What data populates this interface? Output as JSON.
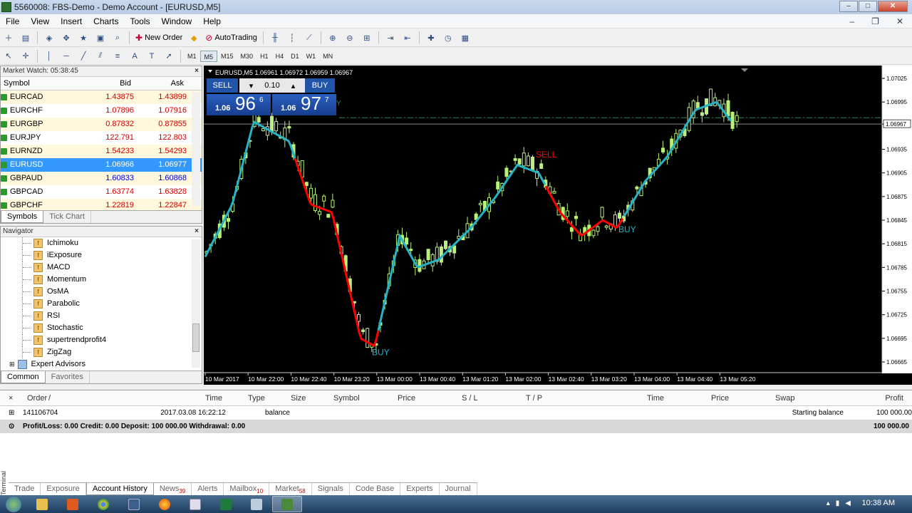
{
  "window": {
    "title": "5560008: FBS-Demo - Demo Account - [EURUSD,M5]"
  },
  "menu": [
    "File",
    "View",
    "Insert",
    "Charts",
    "Tools",
    "Window",
    "Help"
  ],
  "toolbar": {
    "new_order": "New Order",
    "autotrading": "AutoTrading"
  },
  "timeframes": [
    "M1",
    "M5",
    "M15",
    "M30",
    "H1",
    "H4",
    "D1",
    "W1",
    "MN"
  ],
  "active_timeframe": "M5",
  "market_watch": {
    "title": "Market Watch: 05:38:45",
    "columns": [
      "Symbol",
      "Bid",
      "Ask"
    ],
    "rows": [
      {
        "symbol": "EURCAD",
        "bid": "1.43875",
        "ask": "1.43899",
        "dir": "up"
      },
      {
        "symbol": "EURCHF",
        "bid": "1.07896",
        "ask": "1.07916",
        "dir": "up"
      },
      {
        "symbol": "EURGBP",
        "bid": "0.87832",
        "ask": "0.87855",
        "dir": "up"
      },
      {
        "symbol": "EURJPY",
        "bid": "122.791",
        "ask": "122.803",
        "dir": "up"
      },
      {
        "symbol": "EURNZD",
        "bid": "1.54233",
        "ask": "1.54293",
        "dir": "up"
      },
      {
        "symbol": "EURUSD",
        "bid": "1.06966",
        "ask": "1.06977",
        "dir": "up",
        "selected": true
      },
      {
        "symbol": "GBPAUD",
        "bid": "1.60833",
        "ask": "1.60868",
        "dir": "up",
        "blue": true
      },
      {
        "symbol": "GBPCAD",
        "bid": "1.63774",
        "ask": "1.63828",
        "dir": "up"
      },
      {
        "symbol": "GBPCHF",
        "bid": "1.22819",
        "ask": "1.22847",
        "dir": "up"
      }
    ],
    "tabs": [
      "Symbols",
      "Tick Chart"
    ]
  },
  "navigator": {
    "title": "Navigator",
    "items": [
      "Ichimoku",
      "iExposure",
      "MACD",
      "Momentum",
      "OsMA",
      "Parabolic",
      "RSI",
      "Stochastic",
      "supertrendprofit4",
      "ZigZag"
    ],
    "expert_advisors": "Expert Advisors",
    "tabs": [
      "Common",
      "Favorites"
    ]
  },
  "chart": {
    "info": "EURUSD,M5  1.06961 1.06972 1.06959 1.06967",
    "sell_label": "SELL",
    "buy_label": "BUY",
    "lot": "0.10",
    "sell_price": {
      "small": "1.06",
      "big": "96",
      "pip": "6"
    },
    "buy_price": {
      "small": "1.06",
      "big": "97",
      "pip": "7"
    },
    "current_price": "1.06967",
    "price_levels": [
      "1.07025",
      "1.06995",
      "1.06967",
      "1.06935",
      "1.06905",
      "1.06875",
      "1.06845",
      "1.06815",
      "1.06785",
      "1.06755",
      "1.06725",
      "1.06695",
      "1.06665"
    ],
    "time_labels": [
      "10 Mar 2017",
      "10 Mar 22:00",
      "10 Mar 22:40",
      "10 Mar 23:20",
      "13 Mar 00:00",
      "13 Mar 00:40",
      "13 Mar 01:20",
      "13 Mar 02:00",
      "13 Mar 02:40",
      "13 Mar 03:20",
      "13 Mar 04:00",
      "13 Mar 04:40",
      "13 Mar 05:20"
    ],
    "signals": [
      {
        "label": "BUY",
        "color": "#26b3c6"
      },
      {
        "label": "SELL",
        "color": "#ff0000"
      },
      {
        "label": "BUY",
        "color": "#26b3c6"
      }
    ]
  },
  "terminal": {
    "label": "Terminal",
    "columns": [
      "Order",
      "/",
      "Time",
      "Type",
      "Size",
      "Symbol",
      "Price",
      "S / L",
      "T / P",
      "Time",
      "Price",
      "Swap",
      "Profit"
    ],
    "row": {
      "order": "141106704",
      "time": "2017.03.08 16:22:12",
      "type": "balance",
      "comment": "Starting balance",
      "profit": "100 000.00"
    },
    "total": {
      "text": "Profit/Loss: 0.00  Credit: 0.00  Deposit: 100 000.00  Withdrawal: 0.00",
      "profit": "100 000.00"
    },
    "tabs": [
      {
        "label": "Trade"
      },
      {
        "label": "Exposure"
      },
      {
        "label": "Account History",
        "active": true
      },
      {
        "label": "News",
        "count": "39"
      },
      {
        "label": "Alerts"
      },
      {
        "label": "Mailbox",
        "count": "10"
      },
      {
        "label": "Market",
        "count": "58"
      },
      {
        "label": "Signals"
      },
      {
        "label": "Code Base"
      },
      {
        "label": "Experts"
      },
      {
        "label": "Journal"
      }
    ]
  },
  "taskbar": {
    "clock": "10:38 AM"
  }
}
